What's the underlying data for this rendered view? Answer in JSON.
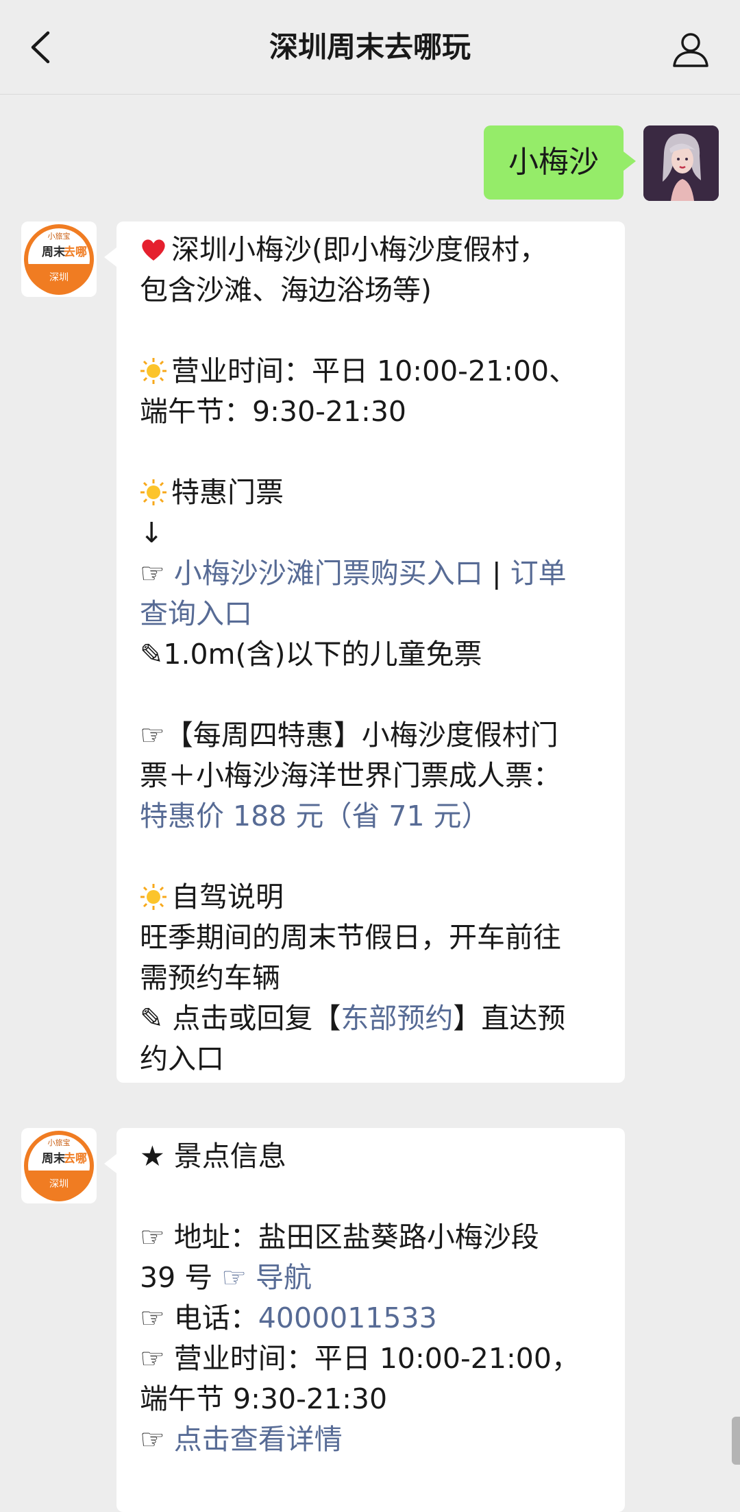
{
  "header": {
    "title": "深圳周末去哪玩"
  },
  "outgoing": {
    "text": "小梅沙"
  },
  "brand_avatar": {
    "top": "小旅宝",
    "main_a": "周末",
    "main_b": "去哪",
    "bottom": "深圳"
  },
  "msg1": {
    "l1": "深圳小梅沙(即小梅沙度假村，",
    "l2": "包含沙滩、海边浴场等)",
    "l3": "营业时间：平日 10:00-21:00、",
    "l4": "端午节：9:30-21:30",
    "l5": "特惠门票",
    "l6": "↓",
    "l7_pointer": "☞ ",
    "l7_link": "小梅沙沙滩门票购买入口",
    "l7_sep": " | ",
    "l7_link2": "订单",
    "l8_link": "查询入口",
    "l9": "✎1.0m(含)以下的儿童免票",
    "l10": "☞【每周四特惠】小梅沙度假村门",
    "l11": "票＋小梅沙海洋世界门票成人票：",
    "l12_link": "特惠价 188 元（省 71 元）",
    "l13": "自驾说明",
    "l14": "旺季期间的周末节假日，开车前往",
    "l15": "需预约车辆",
    "l16_a": "✎ 点击或回复【",
    "l16_link": "东部预约",
    "l16_b": "】直达预",
    "l17": "约入口"
  },
  "msg2": {
    "l1": "★ 景点信息",
    "l2": "☞ 地址：盐田区盐葵路小梅沙段",
    "l3_a": "39 号 ",
    "l3_pointer": "☞ ",
    "l3_link": "导航",
    "l4_a": "☞ 电话：",
    "l4_link": "4000011533",
    "l5": "☞ 营业时间：平日 10:00-21:00，",
    "l6": "端午节 9:30-21:30",
    "l7_a": "☞ ",
    "l7_link": "点击查看详情"
  },
  "colors": {
    "background": "#ededed",
    "outgoing_bubble": "#95ec69",
    "link": "#576b95",
    "brand_orange": "#f07c22"
  },
  "icons": {
    "heart": "red-heart-icon",
    "sun": "sun-icon"
  }
}
